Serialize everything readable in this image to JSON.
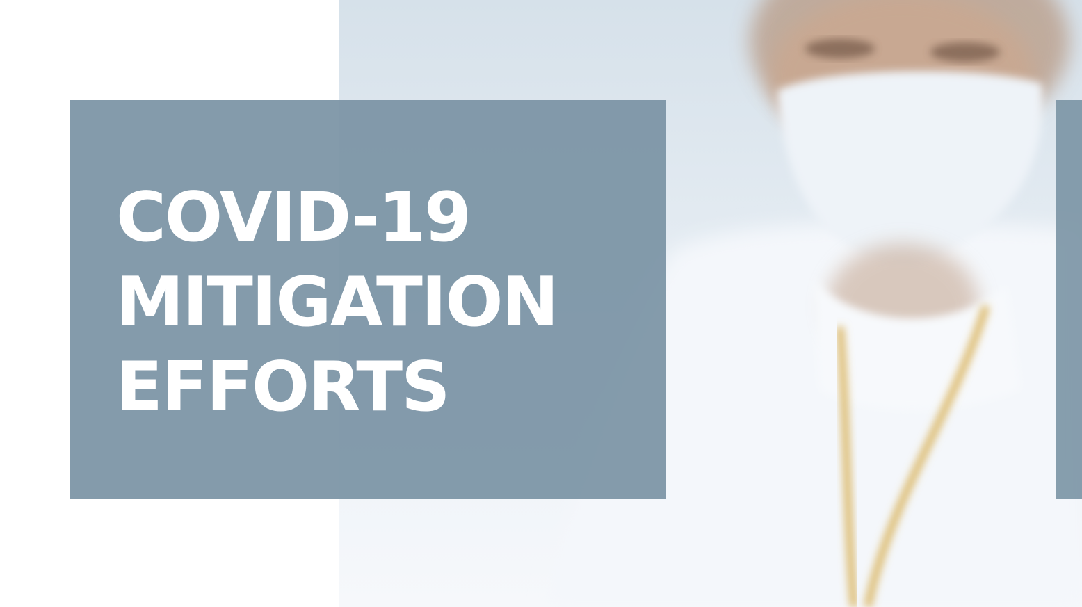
{
  "slide": {
    "title_lines": [
      "COVID-19",
      "MITIGATION",
      "EFFORTS"
    ]
  },
  "photo": {
    "subject": "masked-health-worker-photo"
  },
  "colors": {
    "panel": "#7a93a4",
    "title_text": "#ffffff",
    "background": "#ffffff"
  }
}
